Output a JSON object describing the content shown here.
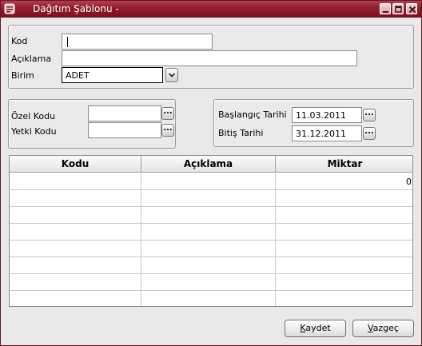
{
  "window": {
    "title": "Dağıtım Şablonu -",
    "controls": [
      "minimize",
      "maximize",
      "close"
    ]
  },
  "header_form": {
    "kod_label": "Kod",
    "kod_value": "",
    "aciklama_label": "Açıklama",
    "aciklama_value": "",
    "birim_label": "Birim",
    "birim_value": "ADET"
  },
  "codes_panel": {
    "ozel_kodu_label": "Özel Kodu",
    "ozel_kodu_value": "",
    "yetki_kodu_label": "Yetki Kodu",
    "yetki_kodu_value": "",
    "lookup_glyph": "..."
  },
  "dates_panel": {
    "baslangic_label": "Başlangıç Tarihi",
    "baslangic_value": "11.03.2011",
    "bitis_label": "Bitiş Tarihi",
    "bitis_value": "31.12.2011"
  },
  "grid": {
    "columns": [
      "Kodu",
      "Açıklama",
      "Miktar"
    ],
    "rows": [
      [
        "",
        "",
        "0"
      ],
      [
        "",
        "",
        ""
      ],
      [
        "",
        "",
        ""
      ],
      [
        "",
        "",
        ""
      ],
      [
        "",
        "",
        ""
      ],
      [
        "",
        "",
        ""
      ],
      [
        "",
        "",
        ""
      ],
      [
        "",
        "",
        ""
      ]
    ]
  },
  "buttons": {
    "save_accel": "K",
    "save_rest": "aydet",
    "cancel_accel": "V",
    "cancel_rest": "azgeç"
  },
  "colors": {
    "titlebar": "#8e1b2c",
    "window_bg": "#e9e9e9"
  }
}
